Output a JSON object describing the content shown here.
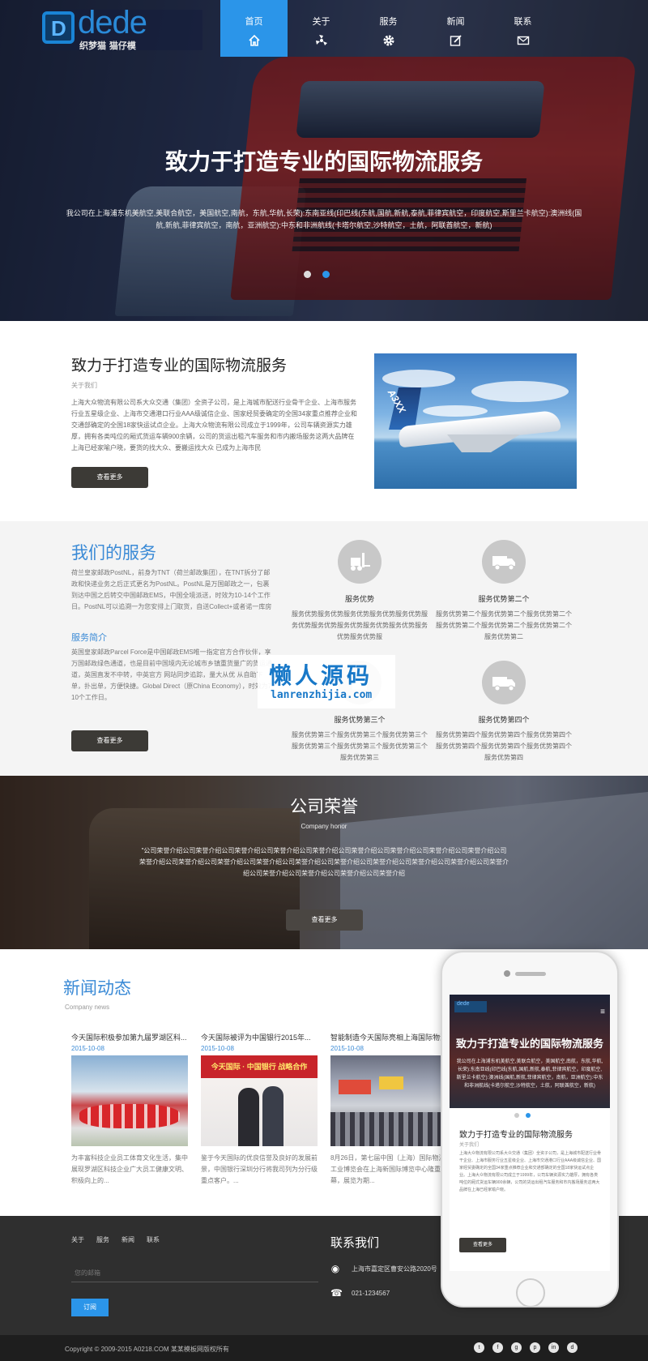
{
  "header": {
    "logo_text": "dede",
    "logo_sub": "织梦猫 猫仔模",
    "nav": [
      {
        "label": "首页",
        "icon": "home-icon"
      },
      {
        "label": "关于",
        "icon": "fan-icon"
      },
      {
        "label": "服务",
        "icon": "gear-icon"
      },
      {
        "label": "新闻",
        "icon": "edit-icon"
      },
      {
        "label": "联系",
        "icon": "mail-icon"
      }
    ],
    "active_index": 0
  },
  "hero": {
    "title": "致力于打造专业的国际物流服务",
    "desc": "我公司在上海浦东机美航空,美联合航空，美国航空,南航，东航,华航,长荣):东南亚线(印巴线(东航,国航,新航,泰航,菲律宾航空，印度航空,斯里兰卡航空):澳洲线(国航,新航,菲律宾航空，南航，亚洲航空):中东和非洲航线(卡塔尔航空,沙特航空，土航，阿联酋航空，新航)",
    "slide_count": 2,
    "active_slide": 1
  },
  "about": {
    "title": "致力于打造专业的国际物流服务",
    "subtitle": "关于我们",
    "text": "上海大众物流有限公司系大众交通（集团）全资子公司，是上海城市配送行业骨干企业、上海市服务行业五星级企业、上海市交通港口行业AAA级诚信企业、国家经贸委确定的全国34家重点推荐企业和交通部确定的全国18家快运试点企业。上海大众物流有限公司成立于1999年，公司车辆资源实力雄厚，拥有各类吨位的厢式货运车辆900余辆，公司的货运出租汽车服务和市内搬场服务这两大品牌在上海已经家喻户晓，要货的找大众、要搬运找大众 已成为上海市民",
    "button": "查看更多",
    "image_tag": "A3XX"
  },
  "services": {
    "title": "我们的服务",
    "intro": "荷兰皇家邮政PostNL，前身为TNT（荷兰邮政集团），在TNT拆分了邮政和快递业务之后正式更名为PostNL。PostNL是万国邮政之一，包裹到达中国之后转交中国邮政EMS，中国全境派送，时效为10-14个工作日。PostNL可以追溯一为您安排上门取货，自送Collect+或者诺一库房",
    "subtitle": "服务简介",
    "intro2": "英国皇家邮政Parcel Force是中国邮政EMS唯一指定官方合作伙伴，享万国邮政绿色通道，也是目前中国境内无论城市乡镇重货量广的货运通道，英国直发不中转，中英官方 网站同步追踪，量大从优 从自助下单，扑出单，方便快捷。Global Direct（原China Economy），时效为7-10个工作日。",
    "button": "查看更多",
    "items": [
      {
        "title": "服务优势",
        "desc": "服务优势服务优势服务优势服务优势服务优势服务优势服务优势服务优势服务优势服务优势服务优势服务优势服",
        "icon": "forklift-icon"
      },
      {
        "title": "服务优势第二个",
        "desc": "服务优势第二个服务优势第二个服务优势第二个服务优势第二个服务优势第二个服务优势第二个服务优势第二",
        "icon": "truck-icon"
      },
      {
        "title": "服务优势第三个",
        "desc": "服务优势第三个服务优势第三个服务优势第三个服务优势第三个服务优势第三个服务优势第三个服务优势第三",
        "icon": "box-icon"
      },
      {
        "title": "服务优势第四个",
        "desc": "服务优势第四个服务优势第四个服务优势第四个服务优势第四个服务优势第四个服务优势第四个服务优势第四",
        "icon": "delivery-truck-icon"
      }
    ]
  },
  "watermark": {
    "line1": "懒人源码",
    "line2": "lanrenzhijia.com"
  },
  "honor": {
    "title": "公司荣誉",
    "en": "Company honor",
    "text": "\"公司荣誉介绍公司荣誉介绍公司荣誉介绍公司荣誉介绍公司荣誉介绍公司荣誉介绍公司荣誉介绍公司荣誉介绍公司荣誉介绍公司荣誉介绍公司荣誉介绍公司荣誉介绍公司荣誉介绍公司荣誉介绍公司荣誉介绍公司荣誉介绍公司荣誉介绍公司荣誉介绍公司荣誉介绍公司荣誉介绍公司荣誉介绍公司荣誉介绍公司荣誉介绍",
    "button": "查看更多"
  },
  "news": {
    "title": "新闻动态",
    "en": "Company news",
    "items": [
      {
        "title": "今天国际积极参加第九届罗湖区科...",
        "date": "2015-10-08",
        "summary": "为丰富科技企业员工体育文化生活，集中展现罗湖区科技企业广大员工健康文明、积极向上的..."
      },
      {
        "title": "今天国际被评为中国银行2015年...",
        "date": "2015-10-08",
        "summary": "鉴于今天国际的优良信誉及良好的发展前景，中国银行深圳分行将我司列为分行级重点客户。..."
      },
      {
        "title": "智能制造今天国际亮相上海国际物流...",
        "date": "2015-10-08",
        "summary": "8月26日，第七届中国（上海）国际物流工业博览会在上海新国际博览中心隆重开幕，展览为期..."
      }
    ],
    "img2_banner": "今天国际 · 中国银行 战略合作"
  },
  "footer": {
    "nav": [
      "关于",
      "服务",
      "新闻",
      "联系"
    ],
    "email_placeholder": "您的邮箱",
    "subscribe": "订阅",
    "contact_title": "联系我们",
    "address": "上海市嘉定区曹安公路2020号",
    "phone": "021-1234567",
    "copyright": "Copyright © 2009-2015 A0218.COM 某某模板网版权所有",
    "social": [
      "twitter-icon",
      "facebook-icon",
      "googleplus-icon",
      "pinterest-icon",
      "linkedin-icon",
      "dribbble-icon"
    ],
    "social_glyphs": [
      "t",
      "f",
      "g",
      "p",
      "in",
      "d"
    ]
  },
  "phone": {
    "logo": "dede",
    "hero_title": "致力于打造专业的国际物流服务",
    "hero_desc": "我公司在上海浦东机美航空,美联合航空，美国航空,南航，东航,华航,长荣):东南亚线(印巴线(东航,国航,新航,泰航,菲律宾航空，印度航空,斯里兰卡航空):澳洲线(国航,新航,菲律宾航空，南航，亚洲航空):中东和非洲航线(卡塔尔航空,沙特航空，土航，阿联酋航空，新航)",
    "about_title": "致力于打造专业的国际物流服务",
    "about_sub": "关于我们",
    "about_text": "上海大众物流有限公司系大众交通（集团）全资子公司，是上海城市配送行业骨干企业、上海市服务行业五星级企业、上海市交通港口行业AAA级诚信企业、国家经贸委确定的全国34家重点推荐企业和交通部确定的全国18家快运试点企业。上海大众物流有限公司成立于1999年，公司车辆资源实力雄厚，拥有各类吨位的厢式货运车辆900余辆，公司的货运出租汽车服务和市内搬场服务这两大品牌在上海已经家喻户晓。",
    "button": "查看更多"
  }
}
